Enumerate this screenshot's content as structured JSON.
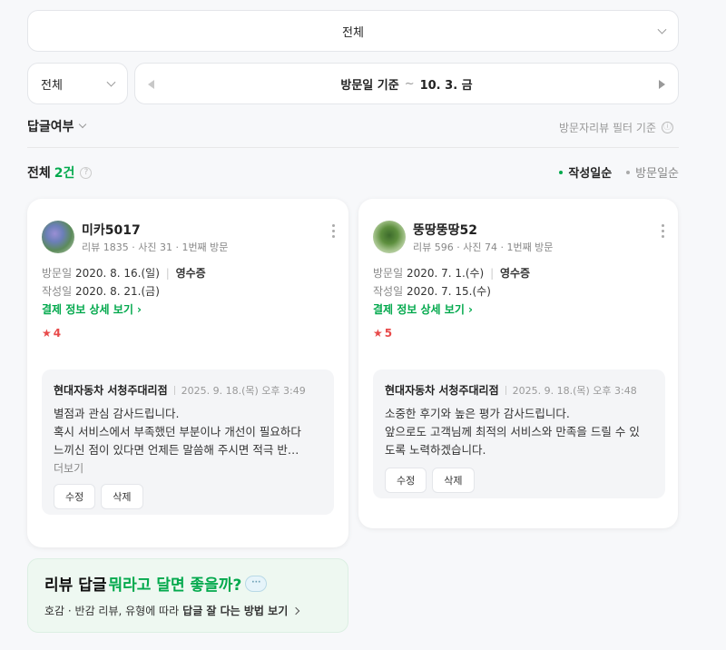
{
  "filters": {
    "all_select": "전체",
    "small_select": "전체",
    "date_start": "방문일 기준",
    "date_sep": "~",
    "date_end": "10. 3. 금",
    "reply_filter": "답글여부",
    "filter_basis": "방문자리뷰 필터 기준",
    "info_icon": "ⓘ"
  },
  "summary": {
    "total_label": "전체",
    "count": "2건",
    "help_icon": "?"
  },
  "sort": {
    "active": "작성일순",
    "inactive": "방문일순"
  },
  "reviews": [
    {
      "nickname": "미카5017",
      "meta": "리뷰 1835 · 사진 31 · 1번째 방문",
      "visit_label": "방문일",
      "visit_date": "2020. 8. 16.(일)",
      "receipt": "영수증",
      "written_label": "작성일",
      "written_date": "2020. 8. 21.(금)",
      "detail_link": "결제 정보 상세 보기 ›",
      "rating": "4",
      "reply": {
        "store": "현대자동차 서청주대리점",
        "date": "2025. 9. 18.(목) 오후 3:49",
        "lines": [
          "별점과 관심 감사드립니다.",
          "혹시 서비스에서 부족했던 부분이나 개선이 필요하다",
          "느끼신 점이 있다면 언제든 말씀해 주시면 적극 반…"
        ],
        "more": "더보기",
        "edit": "수정",
        "delete": "삭제"
      }
    },
    {
      "nickname": "뚱땅뚱땅52",
      "meta": "리뷰 596 · 사진 74 · 1번째 방문",
      "visit_label": "방문일",
      "visit_date": "2020. 7. 1.(수)",
      "receipt": "영수증",
      "written_label": "작성일",
      "written_date": "2020. 7. 15.(수)",
      "detail_link": "결제 정보 상세 보기 ›",
      "rating": "5",
      "reply": {
        "store": "현대자동차 서청주대리점",
        "date": "2025. 9. 18.(목) 오후 3:48",
        "lines": [
          "소중한 후기와 높은 평가 감사드립니다.",
          "앞으로도 고객님께 최적의 서비스와 만족을 드릴 수 있",
          "도록 노력하겠습니다."
        ],
        "edit": "수정",
        "delete": "삭제"
      }
    }
  ],
  "banner": {
    "title_plain": "리뷰 답글",
    "title_green": "뭐라고 달면 좋을까?",
    "bubble": "···",
    "sub_plain": "호감 · 반감 리뷰, 유형에 따라",
    "sub_bold": "답글 잘 다는 방법 보기"
  },
  "colors": {
    "accent": "#03a94d",
    "star": "#e84a4a"
  }
}
